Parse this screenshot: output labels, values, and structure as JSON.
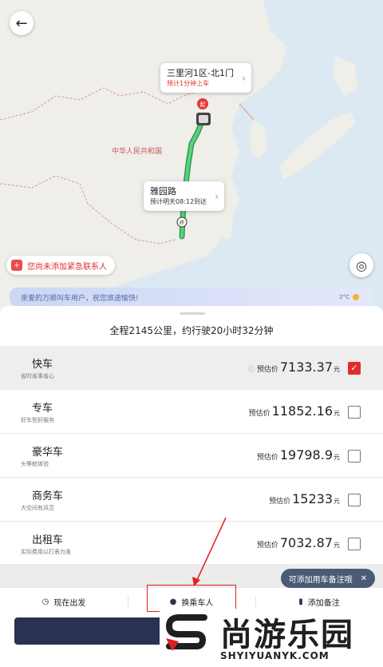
{
  "map": {
    "country_label": "中华人民共和国",
    "pickup": {
      "badge": "起",
      "title": "三里河1区-北1门",
      "subtitle": "预计1分钟上车"
    },
    "via": {
      "title": "雅园路",
      "subtitle": "预计明天08:12到达"
    },
    "end_badge": "终"
  },
  "emergency": {
    "text": "您尚未添加紧急联系人"
  },
  "greeting": {
    "text": "亲爱的万顺叫车用户，祝您旅途愉快!",
    "temp": "2°C"
  },
  "summary": "全程2145公里，约行驶20小时32分钟",
  "price_label": "预估价",
  "currency": "元",
  "cars": [
    {
      "name": "快车",
      "desc": "省时省事省心",
      "price": "7133.37",
      "checked": true
    },
    {
      "name": "专车",
      "desc": "好车型好服务",
      "price": "11852.16",
      "checked": false
    },
    {
      "name": "豪华车",
      "desc": "头等舱体验",
      "price": "19798.9",
      "checked": false
    },
    {
      "name": "商务车",
      "desc": "大空间有风范",
      "price": "15233",
      "checked": false
    },
    {
      "name": "出租车",
      "desc": "实际费用以打表为准",
      "price": "7032.87",
      "checked": false
    }
  ],
  "tip": {
    "text": "可添加用车备注哦",
    "close": "✕"
  },
  "options": [
    {
      "label": "现在出发",
      "icon": "clock-icon"
    },
    {
      "label": "换乘车人",
      "icon": "person-icon"
    },
    {
      "label": "添加备注",
      "icon": "bookmark-icon"
    }
  ],
  "watermark": {
    "name": "尚游乐园",
    "domain": "SHYIYUANYK.COM"
  }
}
